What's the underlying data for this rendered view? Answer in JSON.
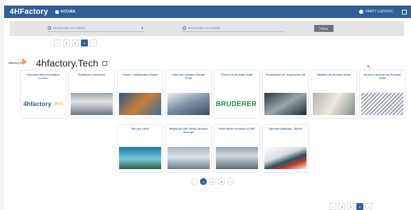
{
  "header": {
    "app_name": "4HFactory",
    "home_label": "ACCUEIL",
    "user_label": "PARTY LUDOVIC",
    "bar_color": "#2f5f96"
  },
  "filters": {
    "theme_placeholder": "Rechercher une thème",
    "module_placeholder": "Rechercher un module",
    "filter_button": "Filtres"
  },
  "top_pager": [
    "‹",
    "1",
    "2",
    "3",
    "›"
  ],
  "top_pager_active": "3",
  "page": {
    "brand": "4hfactory.Tech",
    "title": "4hfactory.Tech"
  },
  "cards_row1": [
    {
      "title": "Documentation technique cursus",
      "image": "4hfactory.tech logo"
    },
    {
      "title": "Solutions connectées",
      "image": "photo"
    },
    {
      "title": "Cobot : Collaboration Robot",
      "image": "photo"
    },
    {
      "title": "Vidéo bol robotisé FSA par Prins",
      "image": "photo"
    },
    {
      "title": "Presse de découpe métal",
      "image": "BRUDERER logo"
    },
    {
      "title": "Présentation de l'impression 3D",
      "image": "photo"
    },
    {
      "title": "Machine de découpe métal",
      "image": "photo"
    },
    {
      "title": "Atelier et process de découpe métal",
      "image": "photo"
    }
  ],
  "cards_row2": [
    {
      "title": "Mini jeu robot",
      "image": "photo"
    },
    {
      "title": "Emporium 360° atelier process découpe",
      "image": "photo"
    },
    {
      "title": "Visite atelier découpe en 360°",
      "image": "photo"
    },
    {
      "title": "Injection plastique - Billon",
      "image": "photo"
    }
  ],
  "mid_pager": [
    "‹",
    "1",
    "2",
    "3",
    "›"
  ],
  "mid_pager_active": "1",
  "bottom_pager": [
    "‹",
    "1",
    "2",
    "3",
    "›"
  ],
  "bottom_pager_active": "3",
  "bruderer_text": "BRUDERER",
  "logo_text": "4hfactory",
  "logo_sub": ".tech"
}
